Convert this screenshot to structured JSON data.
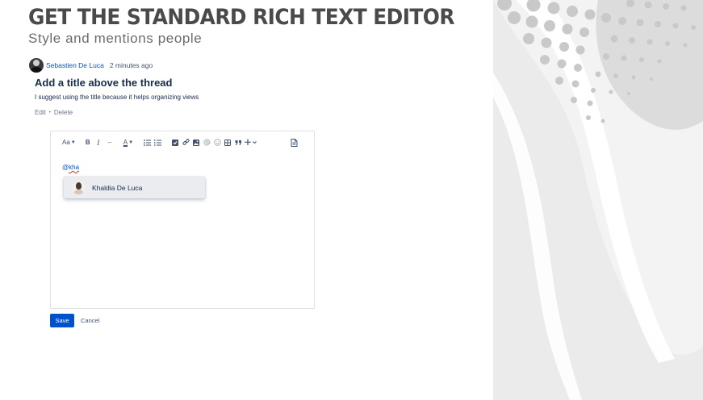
{
  "hero": {
    "title": "GET THE STANDARD RICH TEXT EDITOR",
    "subtitle": "Style and mentions people"
  },
  "comment": {
    "author": "Sebastien De Luca",
    "time": "2 minutes ago",
    "title": "Add a title above the thread",
    "body": "I suggest using the title because it helps organizing views",
    "edit_label": "Edit",
    "separator": "•",
    "delete_label": "Delete"
  },
  "editor": {
    "toolbar": {
      "text_style": "Aa",
      "bold": "B",
      "italic": "I",
      "more": "···",
      "text_color": "A",
      "icons": [
        "bullet-list-icon",
        "numbered-list-icon",
        "action-item-icon",
        "link-icon",
        "image-icon",
        "mention-icon",
        "emoji-icon",
        "table-icon",
        "quote-icon",
        "insert-icon",
        "template-icon"
      ]
    },
    "content": {
      "mention_prefix": "@",
      "mention_query": "kha"
    },
    "mention_suggestions": [
      {
        "name": "Khaldia De Luca"
      }
    ]
  },
  "buttons": {
    "save": "Save",
    "cancel": "Cancel"
  },
  "colors": {
    "accent": "#0052cc",
    "hero_text": "#4a4a4a",
    "panel_background": "#f4f4f4"
  }
}
